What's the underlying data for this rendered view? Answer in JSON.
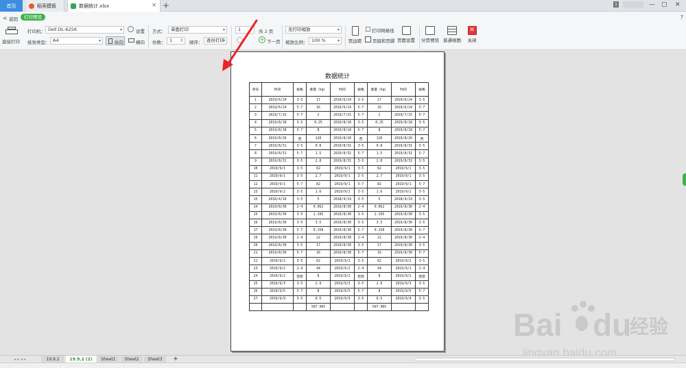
{
  "tabs": {
    "home": "首页",
    "tab1": "稻壳模板",
    "tab2": "数据统计.xlsx"
  },
  "toolbar": {
    "back": "返回",
    "mode": "打印预览",
    "direct_print": "直接打印",
    "printer_label": "打印机：",
    "printer_value": "Dell DL-625K",
    "settings": "设置",
    "paper_label": "纸张类型：",
    "paper_value": "A4",
    "portrait": "纵向",
    "landscape": "横向",
    "method_label": "方式：",
    "method_value": "单面打印",
    "copies_label": "份数：",
    "copies_value": "1",
    "order_label": "顺序：",
    "order_value": "逐份打印",
    "page_value": "1",
    "total_pages": "共 2 页",
    "next_page": "下一页",
    "scale_option": "无打印缩放",
    "zoom_label": "缩放比例：",
    "zoom_value": "100 %",
    "margins": "页边距",
    "gridlines": "打印网格线",
    "header_footer": "页眉和页脚",
    "page_setup": "页面设置",
    "page_break_preview": "分页预览",
    "normal_view": "普通视图",
    "close": "关闭"
  },
  "sheet": {
    "title": "数据统计",
    "headers": [
      "序号",
      "时间",
      "规格",
      "重量（kg）",
      "时间",
      "规格",
      "重量（kg）",
      "时间",
      "规格"
    ],
    "rows": [
      [
        "1",
        "2019/6/24",
        "3-5",
        "17",
        "2019/6/24",
        "3-5",
        "17",
        "2019/6/24",
        "3-5"
      ],
      [
        "2",
        "2019/6/24",
        "5-7",
        "16",
        "2019/6/24",
        "5-7",
        "16",
        "2019/6/24",
        "5-7"
      ],
      [
        "3",
        "2019/7/15",
        "5-7",
        "2",
        "2019/7/15",
        "5-7",
        "2",
        "2019/7/15",
        "5-7"
      ],
      [
        "4",
        "2019/8/18",
        "3-5",
        "0.25",
        "2019/8/18",
        "3-5",
        "0.25",
        "2019/8/18",
        "3-5"
      ],
      [
        "5",
        "2019/8/18",
        "5-7",
        "8",
        "2019/8/18",
        "5-7",
        "8",
        "2019/8/18",
        "5-7"
      ],
      [
        "6",
        "2019/8/20",
        "芭",
        "120",
        "2019/8/20",
        "芭",
        "120",
        "2019/8/20",
        "芭"
      ],
      [
        "7",
        "2019/8/31",
        "3-5",
        "0.8",
        "2019/8/31",
        "3-5",
        "0.8",
        "2019/8/31",
        "3-5"
      ],
      [
        "8",
        "2019/8/31",
        "5-7",
        "1.5",
        "2019/8/31",
        "5-7",
        "1.5",
        "2019/8/31",
        "5-7"
      ],
      [
        "9",
        "2019/8/31",
        "3-5",
        "2.8",
        "2019/8/31",
        "3-5",
        "2.8",
        "2019/8/31",
        "3-5"
      ],
      [
        "10",
        "2019/9/1",
        "3-5",
        "62",
        "2019/9/1",
        "3-5",
        "62",
        "2019/9/1",
        "3-5"
      ],
      [
        "11",
        "2019/9/1",
        "3-5",
        "2.7",
        "2019/9/1",
        "3-5",
        "2.7",
        "2019/9/1",
        "3-5"
      ],
      [
        "12",
        "2019/9/1",
        "5-7",
        "82",
        "2019/9/1",
        "5-7",
        "82",
        "2019/9/1",
        "5-7"
      ],
      [
        "13",
        "2019/9/2",
        "3-5",
        "1.6",
        "2019/9/2",
        "3-5",
        "1.6",
        "2019/9/2",
        "3-5"
      ],
      [
        "15",
        "2018/4/19",
        "3-5",
        "5",
        "2018/4/19",
        "3-5",
        "5",
        "2018/4/19",
        "3-5"
      ],
      [
        "14",
        "2019/8/30",
        "2-4",
        "0.062",
        "2019/8/30",
        "2-4",
        "0.062",
        "2019/8/30",
        "2-4"
      ],
      [
        "15",
        "2019/8/30",
        "3-5",
        "2.195",
        "2019/8/30",
        "3-5",
        "2.195",
        "2019/8/30",
        "3-5"
      ],
      [
        "16",
        "2019/8/30",
        "3-5",
        "3.5",
        "2019/8/30",
        "3-5",
        "3.5",
        "2019/8/30",
        "3-5"
      ],
      [
        "17",
        "2019/8/30",
        "5-7",
        "0.158",
        "2019/8/30",
        "5-7",
        "0.158",
        "2019/8/30",
        "5-7"
      ],
      [
        "19",
        "2019/8/30",
        "2-4",
        "22",
        "2019/8/30",
        "2-4",
        "22",
        "2019/8/30",
        "2-4"
      ],
      [
        "20",
        "2019/8/30",
        "3-5",
        "17",
        "2019/8/30",
        "3-5",
        "17",
        "2019/8/30",
        "3-5"
      ],
      [
        "21",
        "2019/8/30",
        "5-7",
        "16",
        "2019/8/30",
        "5-7",
        "16",
        "2019/8/30",
        "5-7"
      ],
      [
        "22",
        "2019/9/2",
        "3-5",
        "62",
        "2019/9/2",
        "3-5",
        "62",
        "2019/9/2",
        "3-5"
      ],
      [
        "23",
        "2019/9/2",
        "2-4",
        "44",
        "2019/9/2",
        "2-4",
        "44",
        "2019/9/2",
        "2-4"
      ],
      [
        "24",
        "2019/9/2",
        "芭营",
        "8",
        "2019/9/2",
        "芭营",
        "8",
        "2019/9/2",
        "芭营"
      ],
      [
        "25",
        "2019/9/3",
        "3-5",
        "2.9",
        "2019/9/3",
        "3-5",
        "2.9",
        "2019/9/3",
        "3-5"
      ],
      [
        "26",
        "2019/9/5",
        "5-7",
        "8",
        "2019/9/5",
        "5-7",
        "8",
        "2019/9/5",
        "5-7"
      ],
      [
        "27",
        "2019/9/9",
        "3-5",
        "0.5",
        "2019/9/9",
        "3-5",
        "0.5",
        "2019/9/9",
        "3-5"
      ]
    ],
    "total_row": [
      "",
      "",
      "",
      "507.965",
      "",
      "",
      "507.965",
      "",
      ""
    ]
  },
  "sheet_tabs": [
    "19.9.2",
    "19.9.2 (2)",
    "Sheet1",
    "Sheet2",
    "Sheet3"
  ],
  "watermark": {
    "brand": "Bai",
    "brand2": "du",
    "cn": "经验",
    "url": "jingyan.baidu.com"
  },
  "colors": {
    "accent_green": "#3bb34a",
    "tab_blue": "#3b8ee0",
    "arrow_red": "#e8262a"
  }
}
